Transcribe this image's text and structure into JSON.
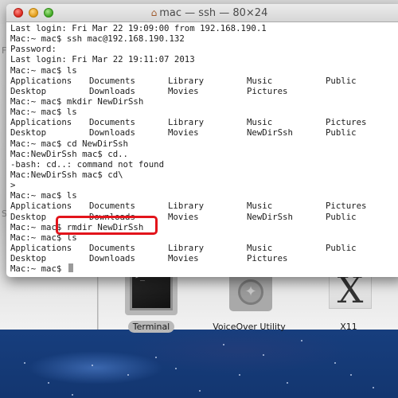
{
  "window": {
    "title": "mac — ssh — 80×24",
    "title_icon": "home-icon",
    "buttons": {
      "close": "close-button",
      "minimize": "minimize-button",
      "zoom": "zoom-button"
    }
  },
  "terminal": {
    "lines": [
      {
        "type": "text",
        "text": "Last login: Fri Mar 22 19:09:00 from 192.168.190.1"
      },
      {
        "type": "text",
        "text": "Mac:~ mac$ ssh mac@192.168.190.132"
      },
      {
        "type": "text",
        "text": "Password:"
      },
      {
        "type": "text",
        "text": "Last login: Fri Mar 22 19:11:07 2013"
      },
      {
        "type": "text",
        "text": "Mac:~ mac$ ls"
      },
      {
        "type": "ls",
        "cols": [
          "Applications",
          "Documents",
          "Library",
          "Music",
          "Public"
        ]
      },
      {
        "type": "ls",
        "cols": [
          "Desktop",
          "Downloads",
          "Movies",
          "Pictures",
          ""
        ]
      },
      {
        "type": "text",
        "text": "Mac:~ mac$ mkdir NewDirSsh"
      },
      {
        "type": "text",
        "text": "Mac:~ mac$ ls"
      },
      {
        "type": "ls",
        "cols": [
          "Applications",
          "Documents",
          "Library",
          "Music",
          "Pictures"
        ]
      },
      {
        "type": "ls",
        "cols": [
          "Desktop",
          "Downloads",
          "Movies",
          "NewDirSsh",
          "Public"
        ]
      },
      {
        "type": "text",
        "text": "Mac:~ mac$ cd NewDirSsh"
      },
      {
        "type": "text",
        "text": "Mac:NewDirSsh mac$ cd.."
      },
      {
        "type": "text",
        "text": "-bash: cd..: command not found"
      },
      {
        "type": "text",
        "text": "Mac:NewDirSsh mac$ cd\\"
      },
      {
        "type": "text",
        "text": ">"
      },
      {
        "type": "text",
        "text": "Mac:~ mac$ ls"
      },
      {
        "type": "ls",
        "cols": [
          "Applications",
          "Documents",
          "Library",
          "Music",
          "Pictures"
        ]
      },
      {
        "type": "ls",
        "cols": [
          "Desktop",
          "Downloads",
          "Movies",
          "NewDirSsh",
          "Public"
        ]
      },
      {
        "type": "text",
        "text": "Mac:~ mac$ rmdir NewDirSsh",
        "highlighted": "rmdir NewDirSsh"
      },
      {
        "type": "text",
        "text": "Mac:~ mac$ ls"
      },
      {
        "type": "ls",
        "cols": [
          "Applications",
          "Documents",
          "Library",
          "Music",
          "Public"
        ]
      },
      {
        "type": "ls",
        "cols": [
          "Desktop",
          "Downloads",
          "Movies",
          "Pictures",
          ""
        ]
      },
      {
        "type": "prompt",
        "text": "Mac:~ mac$ "
      }
    ],
    "highlight_color": "#e2141b"
  },
  "finder": {
    "items": [
      {
        "label": "Terminal",
        "icon": "terminal-icon",
        "selected": true
      },
      {
        "label": "VoiceOver Utility",
        "icon": "voiceover-utility-icon",
        "selected": false
      },
      {
        "label": "X11",
        "icon": "x11-icon",
        "selected": false
      }
    ],
    "terminal_glyph": ">_",
    "x11_glyph": "X",
    "sidebar_letters": [
      "F",
      "S"
    ]
  }
}
